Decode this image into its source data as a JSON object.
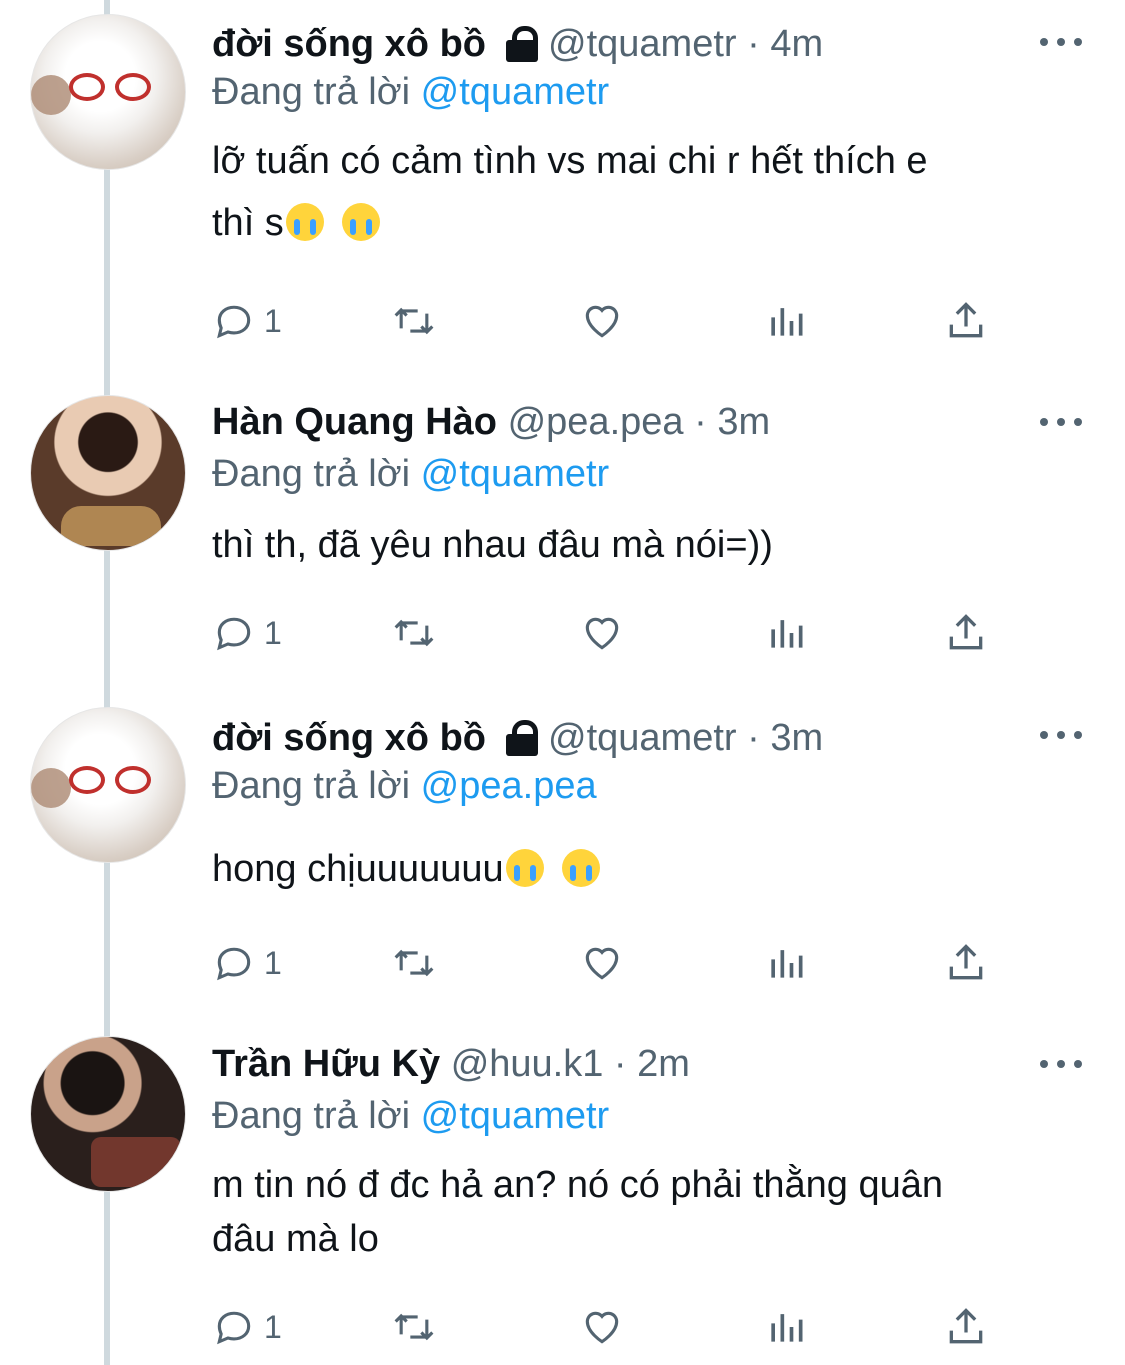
{
  "tweets": [
    {
      "name": "đời sống xô bồ",
      "locked": true,
      "handle": "@tquametr",
      "separator": "·",
      "time": "4m",
      "reply_prefix": "Đang trả lời",
      "reply_to": "@tquametr",
      "text_line1": "lỡ tuấn có cảm tình vs mai chi r hết thích e",
      "text_line2": "thì s",
      "reply_count": "1",
      "avatar": "cat-with-red-glasses"
    },
    {
      "name": "Hàn Quang Hào",
      "locked": false,
      "handle": "@pea.pea",
      "separator": "·",
      "time": "3m",
      "reply_prefix": "Đang trả lời",
      "reply_to": "@tquametr",
      "text_line1": "thì th, đã yêu nhau đâu mà nói=))",
      "reply_count": "1",
      "avatar": "young-man-photo"
    },
    {
      "name": "đời sống xô bồ",
      "locked": true,
      "handle": "@tquametr",
      "separator": "·",
      "time": "3m",
      "reply_prefix": "Đang trả lời",
      "reply_to": "@pea.pea",
      "text_line1": "hong chịuuuuuuu",
      "reply_count": "1",
      "avatar": "cat-with-red-glasses"
    },
    {
      "name": "Trần Hữu Kỳ",
      "locked": false,
      "handle": "@huu.k1",
      "separator": "·",
      "time": "2m",
      "reply_prefix": "Đang trả lời",
      "reply_to": "@tquametr",
      "text_line1": "m tin nó đ đc hả an? nó có phải thằng quân",
      "text_line2": "đâu mà lo",
      "reply_count": "1",
      "avatar": "young-man-phone-photo"
    }
  ],
  "icons": {
    "lock": "lock-icon",
    "more": "more-icon",
    "reply": "reply-icon",
    "retweet": "retweet-icon",
    "like": "heart-icon",
    "views": "analytics-icon",
    "share": "share-icon",
    "emoji": "loudly-crying-face-emoji"
  },
  "colors": {
    "text": "#0f1419",
    "secondary": "#536471",
    "link": "#1d9bf0",
    "thread_line": "#cfd9de"
  }
}
